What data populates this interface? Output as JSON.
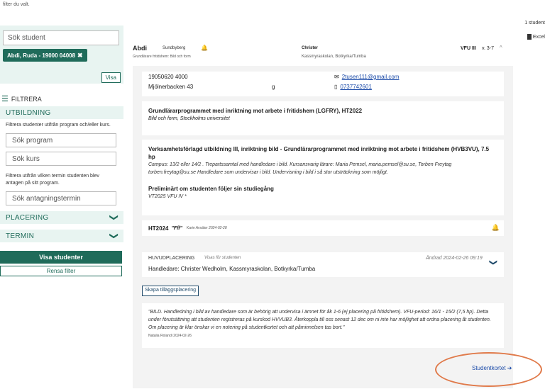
{
  "top_note": "filter du valt.",
  "sidebar": {
    "search_placeholder": "Sök student",
    "chip_label": "Abdi, Ruda - 19000 04008",
    "chip_close": "✖",
    "visa_label": "Visa",
    "filtrera_label": "FILTRERA",
    "utbildning": {
      "title": "UTBILDNING",
      "help": "Filtrera studenter utifrån program och/eller kurs.",
      "program_placeholder": "Sök program",
      "kurs_placeholder": "Sök kurs",
      "termin_help": "Filtrera utifrån vilken termin studenten blev antagen på sitt program.",
      "termin_placeholder": "Sök antagningstermin"
    },
    "placering_title": "PLACERING",
    "termin_title": "TERMIN",
    "visa_studenter": "Visa studenter",
    "rensa_filter": "Rensa filter"
  },
  "main": {
    "count": "1 student",
    "excel": "Excel",
    "student": {
      "name": "Abdi",
      "city": "Sundbyberg",
      "program_short": "Grundlärare fritidshem: Bild och form",
      "handledare": "Christer",
      "school": "Kassmyraskolan, Botkyrka/Tumba",
      "vfu": "VFU III",
      "week": "v. 3-7"
    },
    "contact": {
      "personnr": "19050620 4000",
      "address": "Mjölnerbacken 43",
      "postal": "g",
      "email": "2tusen111@gmail.com",
      "phone": "0737742601"
    },
    "program": {
      "title": "Grundlärarprogrammet med inriktning mot arbete i fritidshem (LGFRY), HT2022",
      "sub": "Bild och form, Stockholms universitet"
    },
    "course": {
      "title": "Verksamhetsförlagd utbildning III, inriktning bild - Grundlärarprogrammet med inriktning mot arbete i fritidshem (HVB3VU), 7.5 hp",
      "desc": "Campus: 13/2 eller 14/2 . Trepartssamtal med handledare i bild. Kursansvarig lärare: Maria Pemsel, maria.pemsel@su.se, Torben Freytag torben.freytag@su.se Handledare som undervisar i bild. Undervisning i bild i så stor utsträckning som möjligt.",
      "prelim_title": "Preliminärt om studenten följer sin studiegång",
      "prelim_sub": "VT2025 VFU IV *"
    },
    "note": {
      "term": "HT2024",
      "quote": "\"Fff\"",
      "meta": "Karin Avsäter 2024-02-28"
    },
    "placement": {
      "label": "HUVUDPLACERING",
      "visibility": "Visas för studenten",
      "changed": "Ändrad 2024-02-26 09:19",
      "handledare": "Handledare: Christer Wedholm, Kassmyraskolan, Botkyrka/Tumba"
    },
    "tillagg_button": "Skapa tilläggsplacering",
    "comment": {
      "text": "\"BILD. Handledning i bild av handledare som är behörig att undervisa i ämnet för åk 1-6 (ej placering på fritidshem). VFU-period: 16/1 - 15/2 (7,5 hp). Detta under förutsättning att studenten registreras på kurskod HVVUB3. Återkoppla till oss senast 12 dec om ni inte har möjlighet att ordna placering åt studenten.  Om placering är klar önskar vi en notering på studentkortet och att påminnelsen tas bort.\"",
      "signature": "Natalia Rolandi 2024-02-26"
    },
    "studentkortet": "Studentkortet ➔"
  },
  "icons": {
    "bell": "🔔",
    "mail": "✉",
    "phone": "▯",
    "chevron_down": "❯",
    "chevron_up": "^"
  },
  "colors": {
    "accent": "#1f6b5a",
    "panel": "#e8f4f1",
    "link": "#1a4aa8",
    "alert": "#dd3322",
    "highlight": "#e07a4a"
  }
}
